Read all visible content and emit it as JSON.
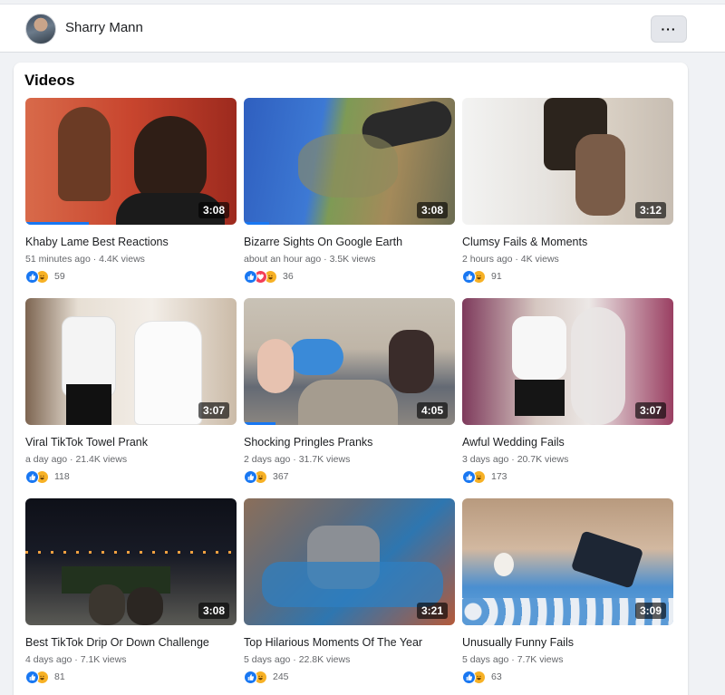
{
  "profile": {
    "name": "Sharry Mann",
    "more_label": "···"
  },
  "section": {
    "title": "Videos"
  },
  "videos": [
    {
      "title": "Khaby Lame Best Reactions",
      "meta": "51 minutes ago · 4.4K views",
      "duration": "3:08",
      "reactions": [
        "like",
        "haha"
      ],
      "reaction_count": "59",
      "progress": 0.3
    },
    {
      "title": "Bizarre Sights On Google Earth",
      "meta": "about an hour ago · 3.5K views",
      "duration": "3:08",
      "reactions": [
        "like",
        "love",
        "haha"
      ],
      "reaction_count": "36",
      "progress": 0.12
    },
    {
      "title": "Clumsy Fails & Moments",
      "meta": "2 hours ago · 4K views",
      "duration": "3:12",
      "reactions": [
        "like",
        "haha"
      ],
      "reaction_count": "91",
      "progress": 0
    },
    {
      "title": "Viral TikTok Towel Prank",
      "meta": "a day ago · 21.4K views",
      "duration": "3:07",
      "reactions": [
        "like",
        "haha"
      ],
      "reaction_count": "118",
      "progress": 0
    },
    {
      "title": "Shocking Pringles Pranks",
      "meta": "2 days ago · 31.7K views",
      "duration": "4:05",
      "reactions": [
        "like",
        "haha"
      ],
      "reaction_count": "367",
      "progress": 0.15
    },
    {
      "title": "Awful Wedding Fails",
      "meta": "3 days ago · 20.7K views",
      "duration": "3:07",
      "reactions": [
        "like",
        "haha"
      ],
      "reaction_count": "173",
      "progress": 0
    },
    {
      "title": "Best TikTok Drip Or Down Challenge",
      "meta": "4 days ago · 7.1K views",
      "duration": "3:08",
      "reactions": [
        "like",
        "haha"
      ],
      "reaction_count": "81",
      "progress": 0
    },
    {
      "title": "Top Hilarious Moments Of The Year",
      "meta": "5 days ago · 22.8K views",
      "duration": "3:21",
      "reactions": [
        "like",
        "haha"
      ],
      "reaction_count": "245",
      "progress": 0
    },
    {
      "title": "Unusually Funny Fails",
      "meta": "5 days ago · 7.7K views",
      "duration": "3:09",
      "reactions": [
        "like",
        "haha"
      ],
      "reaction_count": "63",
      "progress": 0
    }
  ],
  "colors": {
    "accent": "#1877f2",
    "like": "#1877f2",
    "love": "#f33e58",
    "haha": "#f7b125"
  }
}
